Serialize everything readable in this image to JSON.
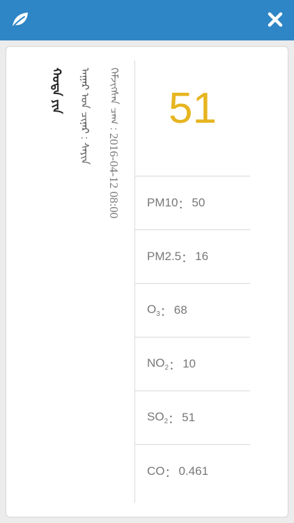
{
  "header": {
    "left_icon": "leaf-icon",
    "right_icon": "close-icon",
    "bar_color": "#2f86c6"
  },
  "info": {
    "line1": "ᠬᠣᠲᠠ ᠶᠢᠨ",
    "line2": "ᠠᠭᠠᠷ ᠤᠨ ᠴᠢᠨᠠᠷ : ᠰᠠᠶᠢᠨ",
    "line3_label": "ᠬᠡᠮᠵᠢᠭᠰᠡᠨ ᠴᠠᠭ : ",
    "line3_time": "2016-04-12 08:00"
  },
  "aqi": {
    "value": "51",
    "color": "#e6b520"
  },
  "pollutants": [
    {
      "name": "PM10",
      "sub": "",
      "value": "50"
    },
    {
      "name": "PM2.5",
      "sub": "",
      "value": "16"
    },
    {
      "name": "O",
      "sub": "3",
      "value": "68"
    },
    {
      "name": "NO",
      "sub": "2",
      "value": "10"
    },
    {
      "name": "SO",
      "sub": "2",
      "value": "51"
    },
    {
      "name": "CO",
      "sub": "",
      "value": "0.461"
    }
  ],
  "separator": "："
}
